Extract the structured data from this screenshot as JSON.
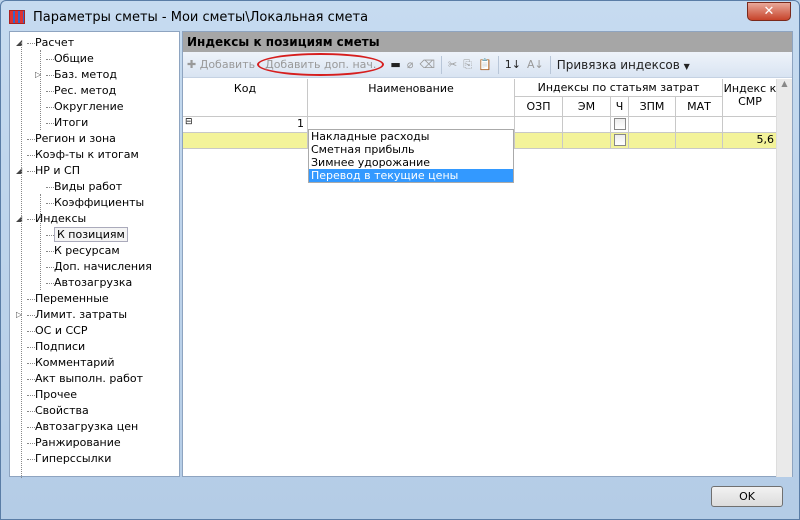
{
  "window": {
    "title": "Параметры сметы - Мои сметы\\Локальная смета",
    "close": "✕"
  },
  "tree": [
    {
      "label": "Расчет",
      "level": 1,
      "exp": "open"
    },
    {
      "label": "Общие",
      "level": 2
    },
    {
      "label": "Баз. метод",
      "level": 2,
      "exp": "closed"
    },
    {
      "label": "Рес. метод",
      "level": 2
    },
    {
      "label": "Округление",
      "level": 2
    },
    {
      "label": "Итоги",
      "level": 2
    },
    {
      "label": "Регион и зона",
      "level": 1
    },
    {
      "label": "Коэф-ты к итогам",
      "level": 1
    },
    {
      "label": "НР и СП",
      "level": 1,
      "exp": "open"
    },
    {
      "label": "Виды работ",
      "level": 2
    },
    {
      "label": "Коэффициенты",
      "level": 2
    },
    {
      "label": "Индексы",
      "level": 1,
      "exp": "open"
    },
    {
      "label": "К позициям",
      "level": 2,
      "selected": true
    },
    {
      "label": "К ресурсам",
      "level": 2
    },
    {
      "label": "Доп. начисления",
      "level": 2
    },
    {
      "label": "Автозагрузка",
      "level": 2
    },
    {
      "label": "Переменные",
      "level": 1
    },
    {
      "label": "Лимит. затраты",
      "level": 1,
      "exp": "closed"
    },
    {
      "label": "ОС и ССР",
      "level": 1
    },
    {
      "label": "Подписи",
      "level": 1
    },
    {
      "label": "Комментарий",
      "level": 1
    },
    {
      "label": "Акт выполн. работ",
      "level": 1
    },
    {
      "label": "Прочее",
      "level": 1
    },
    {
      "label": "Свойства",
      "level": 1
    },
    {
      "label": "Автозагрузка цен",
      "level": 1
    },
    {
      "label": "Ранжирование",
      "level": 1
    },
    {
      "label": "Гиперссылки",
      "level": 1
    }
  ],
  "panel": {
    "title": "Индексы к позициям сметы"
  },
  "toolbar": {
    "add": "Добавить",
    "add_extra": "Добавить доп. нач.",
    "binding": "Привязка индексов"
  },
  "grid": {
    "headers": {
      "code": "Код",
      "name": "Наименование",
      "group": "Индексы по статьям затрат",
      "ozp": "ОЗП",
      "em": "ЭМ",
      "ch": "Ч",
      "zpm": "ЗПМ",
      "mat": "МАТ",
      "smr": "Индекс к СМР"
    },
    "row1": {
      "code": "1"
    },
    "row2": {
      "smr": "5,6"
    }
  },
  "dropdown": [
    "Накладные расходы",
    "Сметная прибыль",
    "Зимнее удорожание",
    "Перевод в текущие цены"
  ],
  "dropdown_selected": 3,
  "ok": "OK"
}
